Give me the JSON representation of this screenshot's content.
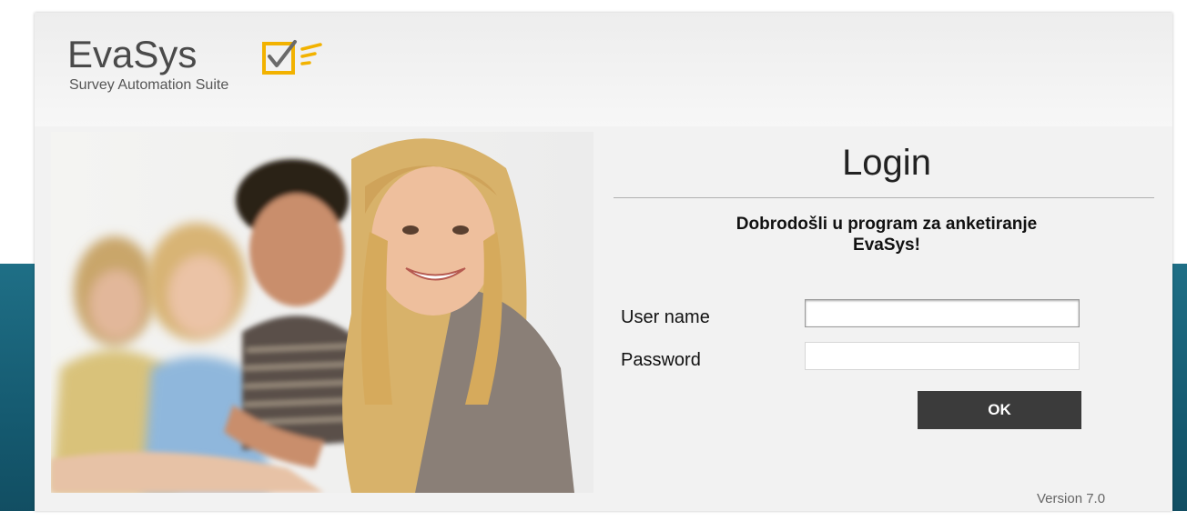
{
  "brand": {
    "name": "EvaSys",
    "tagline": "Survey Automation Suite",
    "colors": {
      "logo_text": "#4a4a4a",
      "check_accent": "#f2b200",
      "check_mark": "#6a6a6a"
    }
  },
  "login": {
    "title": "Login",
    "welcome_line1": "Dobrodošli u program za anketiranje",
    "welcome_line2": "EvaSys!",
    "username_label": "User name",
    "username_value": "",
    "password_label": "Password",
    "password_value": "",
    "ok_label": "OK",
    "version": "Version 7.0"
  },
  "theme": {
    "background_band": "#1f6f86",
    "card_bg": "#f2f2f2",
    "button_bg": "#3b3b3b"
  }
}
